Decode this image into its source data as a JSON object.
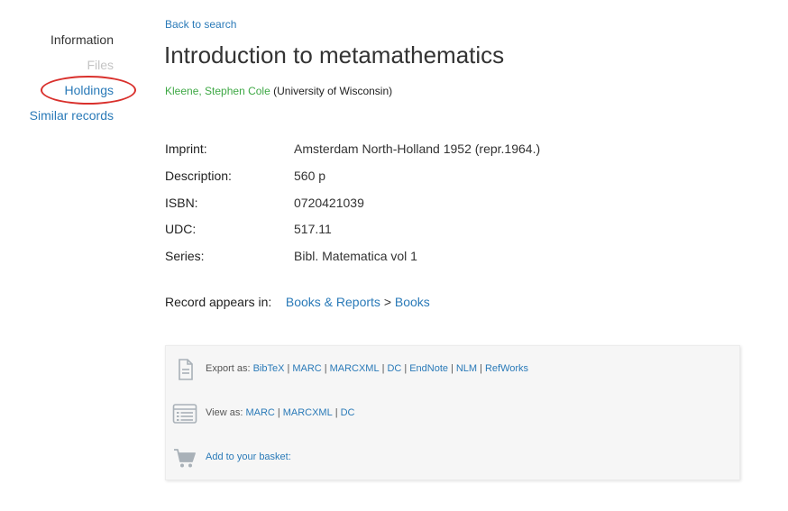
{
  "nav": {
    "information": "Information",
    "files": "Files",
    "holdings": "Holdings",
    "similar": "Similar records"
  },
  "back_link": "Back to search",
  "record": {
    "title": "Introduction to metamathematics",
    "author": "Kleene, Stephen Cole",
    "affiliation": "(University of Wisconsin)"
  },
  "metadata": [
    {
      "label": "Imprint:",
      "value": "Amsterdam North-Holland 1952 (repr.1964.)"
    },
    {
      "label": "Description:",
      "value": "560 p"
    },
    {
      "label": "ISBN:",
      "value": "0720421039"
    },
    {
      "label": "UDC:",
      "value": "517.11"
    },
    {
      "label": "Series:",
      "value": "Bibl. Matematica vol 1"
    }
  ],
  "appears_in": {
    "label": "Record appears in:",
    "links": [
      "Books & Reports",
      "Books"
    ],
    "separator": ">"
  },
  "actions": {
    "export_label": "Export as:",
    "export_formats": [
      "BibTeX",
      "MARC",
      "MARCXML",
      "DC",
      "EndNote",
      "NLM",
      "RefWorks"
    ],
    "view_label": "View as:",
    "view_formats": [
      "MARC",
      "MARCXML",
      "DC"
    ],
    "basket_label": "Add to your basket:"
  },
  "colors": {
    "link": "#2a7ab8",
    "author": "#3ea845",
    "highlight_circle": "#d9302c",
    "icon": "#a9b1b8"
  },
  "icons": {
    "export": "document-icon",
    "view": "list-icon",
    "basket": "cart-icon"
  }
}
